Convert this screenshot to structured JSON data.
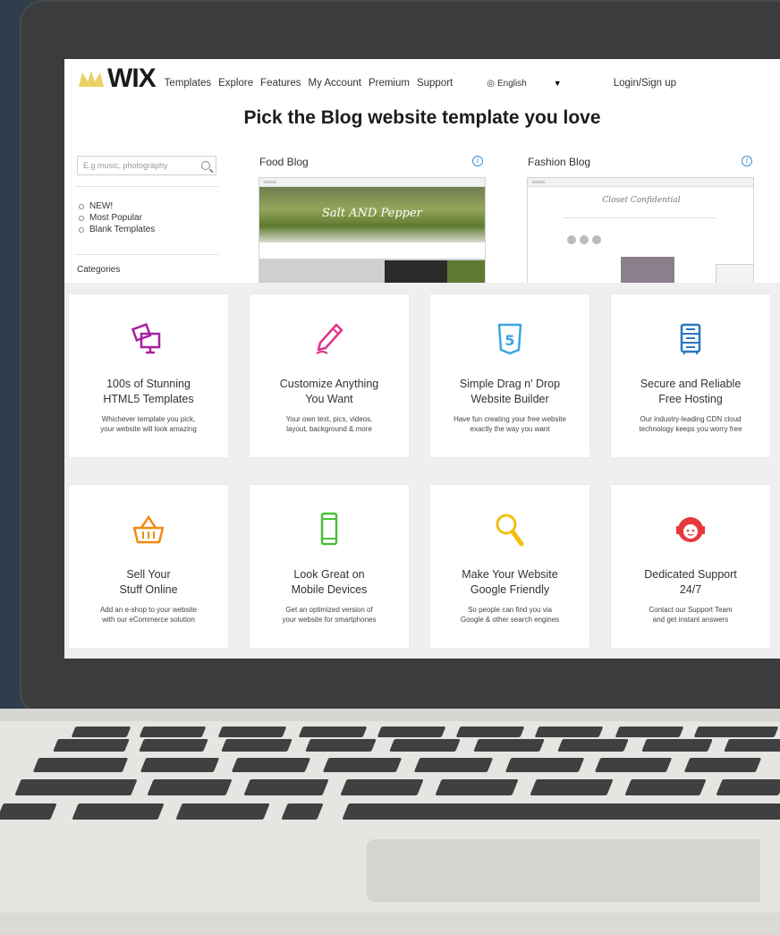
{
  "header": {
    "logo": "WIX",
    "nav": [
      "Templates",
      "Explore",
      "Features",
      "My Account",
      "Premium",
      "Support"
    ],
    "language": "English",
    "login": "Login/Sign up"
  },
  "headline": "Pick the Blog website template you love",
  "sidebar": {
    "search_placeholder": "E.g music, photography",
    "filters": [
      "NEW!",
      "Most Popular",
      "Blank Templates"
    ],
    "categories_label": "Categories"
  },
  "templates": [
    {
      "name": "Food Blog",
      "preview_text": "Salt AND Pepper"
    },
    {
      "name": "Fashion Blog",
      "preview_text": "Closet Confidential"
    }
  ],
  "features": [
    {
      "icon": "templates-icon",
      "color": "#a81fa0",
      "title_1": "100s of Stunning",
      "title_2": "HTML5 Templates",
      "desc_1": "Whichever template you pick,",
      "desc_2": "your website will look amazing"
    },
    {
      "icon": "pencil-icon",
      "color": "#e0308a",
      "title_1": "Customize Anything",
      "title_2": "You Want",
      "desc_1": "Your own text, pics, videos,",
      "desc_2": "layout, background & more"
    },
    {
      "icon": "html5-icon",
      "color": "#3aa5e0",
      "title_1": "Simple Drag n' Drop",
      "title_2": "Website Builder",
      "desc_1": "Have fun creating your free website",
      "desc_2": "exactly the way you want"
    },
    {
      "icon": "server-icon",
      "color": "#2a75c4",
      "title_1": "Secure and Reliable",
      "title_2": "Free Hosting",
      "desc_1": "Our industry-leading CDN cloud",
      "desc_2": "technology keeps you worry free"
    },
    {
      "icon": "basket-icon",
      "color": "#f08a13",
      "title_1": "Sell Your",
      "title_2": "Stuff Online",
      "desc_1": "Add an e-shop to your website",
      "desc_2": "with our eCommerce solution"
    },
    {
      "icon": "mobile-icon",
      "color": "#4cbf3a",
      "title_1": "Look Great on",
      "title_2": "Mobile Devices",
      "desc_1": "Get an optimized version of",
      "desc_2": "your website for smartphones"
    },
    {
      "icon": "magnifier-icon",
      "color": "#f0c012",
      "title_1": "Make Your Website",
      "title_2": "Google Friendly",
      "desc_1": "So people can find you via",
      "desc_2": "Google & other search engines"
    },
    {
      "icon": "support-agent-icon",
      "color": "#e8383e",
      "title_1": "Dedicated Support",
      "title_2": "24/7",
      "desc_1": "Contact our Support Team",
      "desc_2": "and get instant answers"
    }
  ]
}
